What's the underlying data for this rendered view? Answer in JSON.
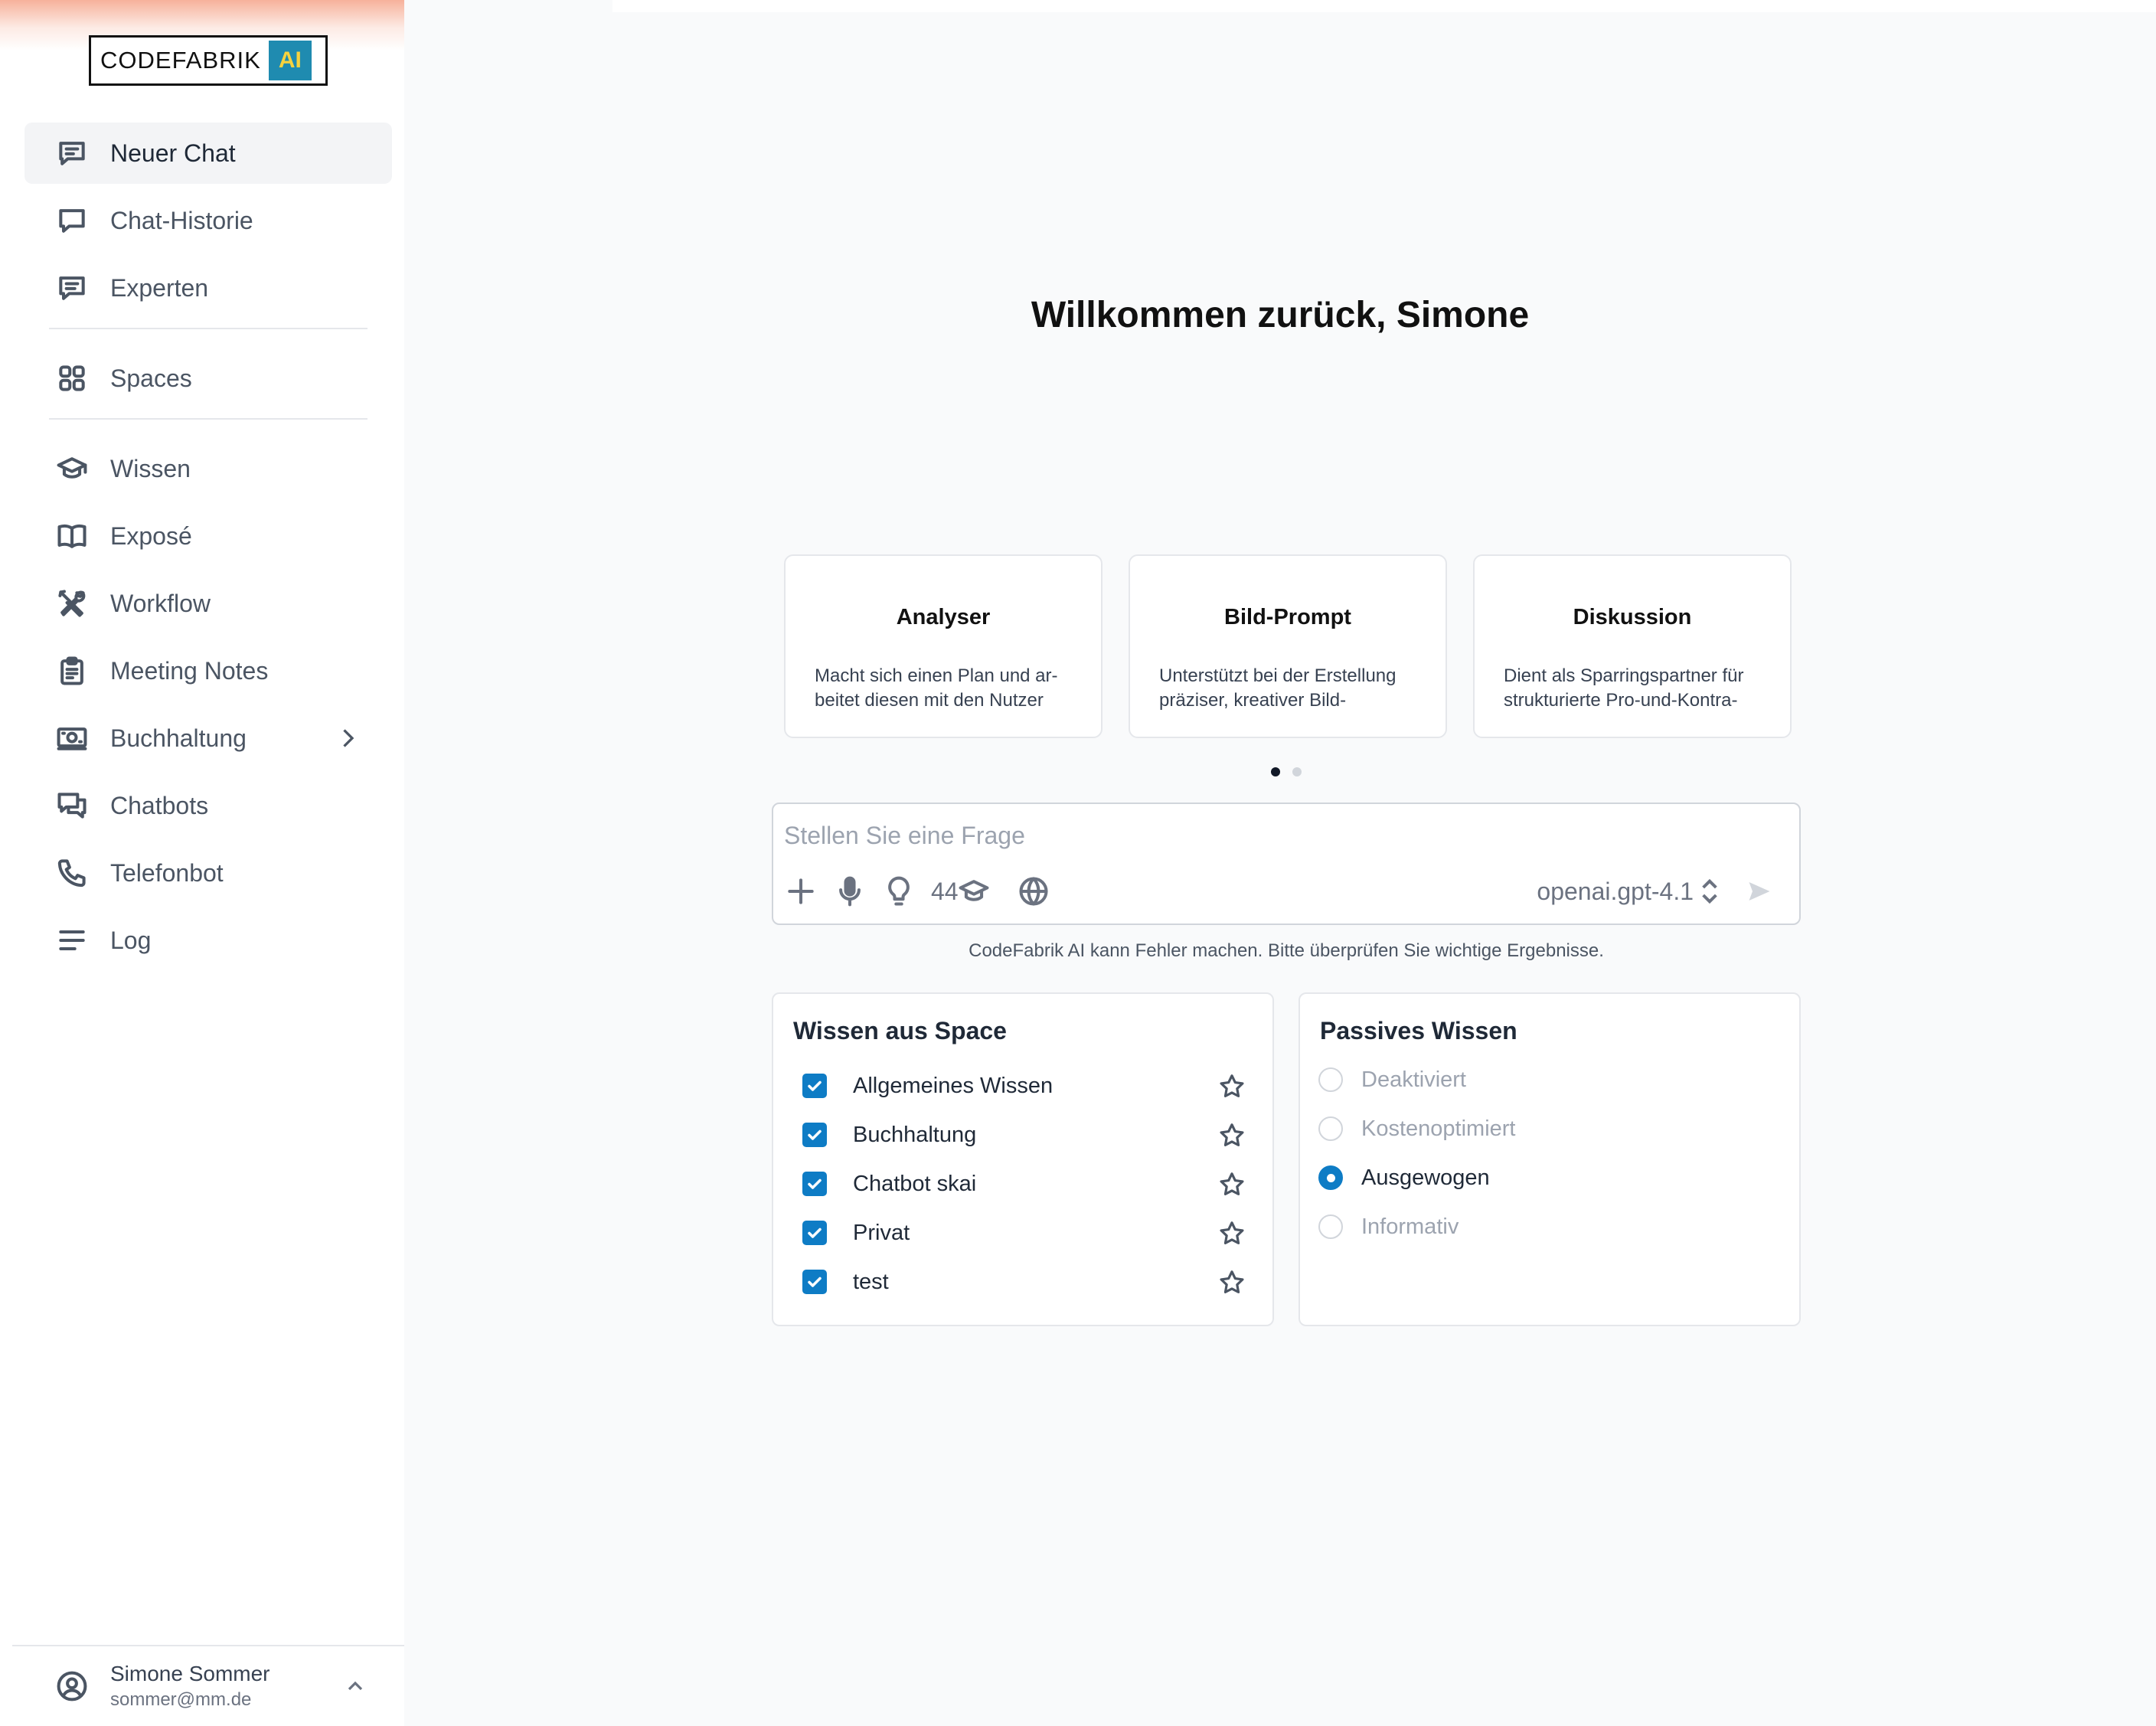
{
  "sidebar": {
    "logo": {
      "text": "CODEFABRIK",
      "badge": "AI"
    },
    "nav_top": [
      {
        "label": "Neuer Chat",
        "icon": "chat-plus-icon",
        "active": true
      },
      {
        "label": "Chat-Historie",
        "icon": "chat-bubble-icon"
      },
      {
        "label": "Experten",
        "icon": "chat-lines-icon"
      }
    ],
    "nav_mid": [
      {
        "label": "Spaces",
        "icon": "grid-icon"
      }
    ],
    "nav_bottom": [
      {
        "label": "Wissen",
        "icon": "graduation-cap-icon"
      },
      {
        "label": "Exposé",
        "icon": "book-open-icon"
      },
      {
        "label": "Workflow",
        "icon": "tools-icon"
      },
      {
        "label": "Meeting Notes",
        "icon": "clipboard-icon"
      },
      {
        "label": "Buchhaltung",
        "icon": "money-icon",
        "has_submenu": true
      },
      {
        "label": "Chatbots",
        "icon": "chats-icon"
      },
      {
        "label": "Telefonbot",
        "icon": "phone-icon"
      },
      {
        "label": "Log",
        "icon": "lines-icon"
      }
    ],
    "user": {
      "name": "Simone Sommer",
      "email": "sommer@mm.de"
    }
  },
  "main": {
    "welcome": "Willkommen zurück, Simone",
    "cards": [
      {
        "title": "Analyser",
        "description": "Macht sich einen Plan und ar-beitet diesen mit den Nutzer"
      },
      {
        "title": "Bild-Prompt",
        "description": "Unterstützt bei der Erstellung präziser, kreativer Bild-"
      },
      {
        "title": "Diskussion",
        "description": "Dient als Sparringspartner für strukturierte Pro-und-Kontra-"
      }
    ],
    "carousel": {
      "pages": 2,
      "current": 1
    },
    "chat": {
      "placeholder": "Stellen Sie eine Frage",
      "knowledge_count": "44",
      "model": "openai.gpt-4.1"
    },
    "disclaimer": "CodeFabrik AI kann Fehler machen. Bitte überprüfen Sie wichtige Ergebnisse.",
    "space_knowledge": {
      "title": "Wissen aus Space",
      "items": [
        {
          "label": "Allgemeines Wissen",
          "checked": true
        },
        {
          "label": "Buchhaltung",
          "checked": true
        },
        {
          "label": "Chatbot skai",
          "checked": true
        },
        {
          "label": "Privat",
          "checked": true
        },
        {
          "label": "test",
          "checked": true
        }
      ]
    },
    "passive_knowledge": {
      "title": "Passives Wissen",
      "options": [
        {
          "label": "Deaktiviert",
          "selected": false
        },
        {
          "label": "Kostenoptimiert",
          "selected": false
        },
        {
          "label": "Ausgewogen",
          "selected": true
        },
        {
          "label": "Informativ",
          "selected": false
        }
      ]
    }
  },
  "colors": {
    "accent": "#0e7cc5",
    "logo_badge_bg": "#1f8bb0",
    "logo_badge_text": "#f7d23e"
  }
}
